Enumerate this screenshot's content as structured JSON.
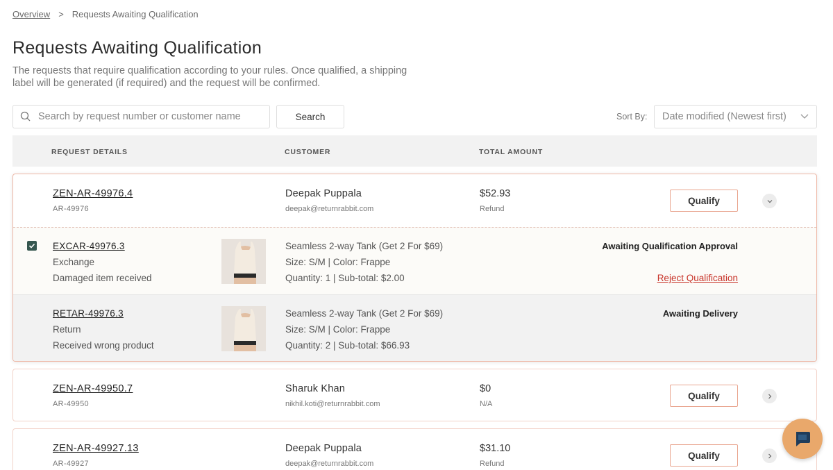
{
  "breadcrumb": {
    "root": "Overview",
    "separator": ">",
    "current": "Requests Awaiting Qualification"
  },
  "page": {
    "title": "Requests Awaiting Qualification",
    "description": "The requests that require qualification according to your rules. Once qualified, a shipping label will be generated (if required) and the request will be confirmed."
  },
  "search": {
    "placeholder": "Search by request number or customer name",
    "button_label": "Search"
  },
  "sort": {
    "label": "Sort By:",
    "selected": "Date modified (Newest first)"
  },
  "table": {
    "headers": [
      "REQUEST DETAILS",
      "CUSTOMER",
      "TOTAL AMOUNT"
    ]
  },
  "requests": [
    {
      "id": "ZEN-AR-49976.4",
      "sub_id": "AR-49976",
      "customer_name": "Deepak Puppala",
      "customer_email": "deepak@returnrabbit.com",
      "amount": "$52.93",
      "amount_type": "Refund",
      "action_label": "Qualify",
      "expanded": true,
      "items": [
        {
          "checked": true,
          "id": "EXCAR-49976.3",
          "type": "Exchange",
          "reason": "Damaged item received",
          "product_name": "Seamless 2-way Tank (Get 2 For $69)",
          "attrs": "Size: S/M | Color: Frappe",
          "qty": "Quantity: 1 | Sub-total: $2.00",
          "status": "Awaiting Qualification Approval",
          "reject_label": "Reject Qualification"
        },
        {
          "checked": false,
          "id": "RETAR-49976.3",
          "type": "Return",
          "reason": "Received wrong product",
          "product_name": "Seamless 2-way Tank (Get 2 For $69)",
          "attrs": "Size: S/M | Color: Frappe",
          "qty": "Quantity: 2 | Sub-total: $66.93",
          "status": "Awaiting Delivery"
        }
      ]
    },
    {
      "id": "ZEN-AR-49950.7",
      "sub_id": "AR-49950",
      "customer_name": "Sharuk Khan",
      "customer_email": "nikhil.koti@returnrabbit.com",
      "amount": "$0",
      "amount_type": "N/A",
      "action_label": "Qualify",
      "expanded": false
    },
    {
      "id": "ZEN-AR-49927.13",
      "sub_id": "AR-49927",
      "customer_name": "Deepak Puppala",
      "customer_email": "deepak@returnrabbit.com",
      "amount": "$31.10",
      "amount_type": "Refund",
      "action_label": "Qualify",
      "expanded": false
    }
  ],
  "colors": {
    "accent_border": "#e9a58f",
    "reject": "#c8342a",
    "checkbox": "#35564f",
    "chat_button": "#e9a86b"
  },
  "icons": {
    "search": "search-icon",
    "sort": "chevron-down-icon",
    "expand": "chevron-down-icon",
    "collapse": "chevron-right-icon",
    "chat": "chat-icon"
  }
}
